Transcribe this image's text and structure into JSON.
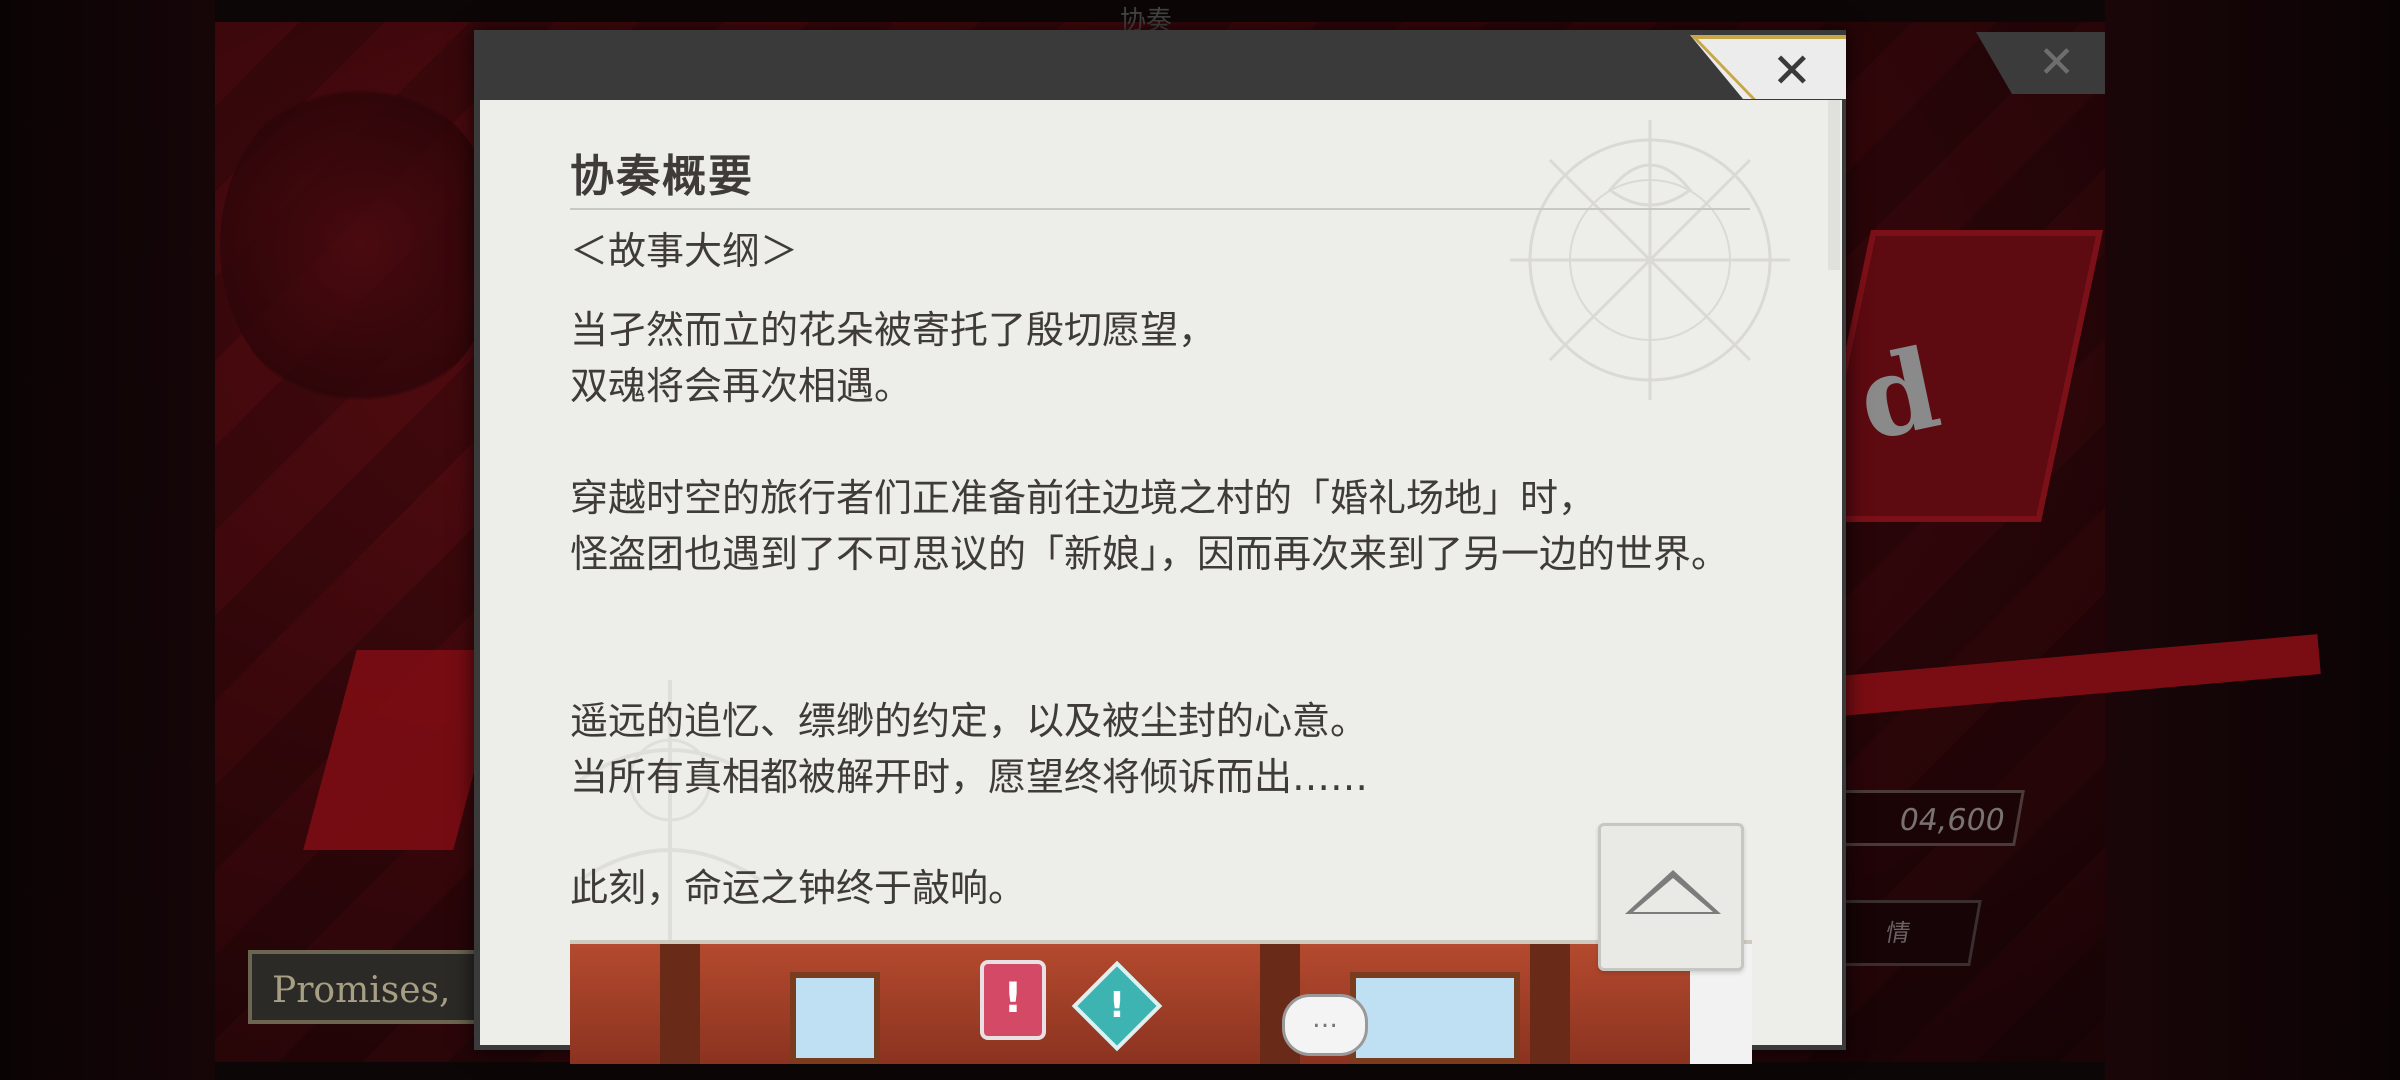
{
  "background": {
    "top_label": "协奏",
    "promises_label": "Promises,",
    "score_value": "04,600",
    "detail_label": "情",
    "card_text": "d",
    "close_symbol": "✕"
  },
  "dialog": {
    "close_symbol": "✕",
    "title": "协奏概要",
    "subtitle": "＜故事大纲＞",
    "paragraphs": [
      "当孑然而立的花朵被寄托了殷切愿望，\n双魂将会再次相遇。",
      "穿越时空的旅行者们正准备前往边境之村的「婚礼场地」时，\n怪盗团也遇到了不可思议的「新娘」，因而再次来到了另一边的世界。",
      "遥远的追忆、缥缈的约定，以及被尘封的心意。\n当所有真相都被解开时，愿望终将倾诉而出……",
      "此刻，命运之钟终于敲响。"
    ],
    "banner": {
      "badge_red": "!",
      "badge_teal": "!",
      "bubble": "…"
    }
  },
  "colors": {
    "dialog_frame": "#3a3a3a",
    "content_bg": "#ededea",
    "text": "#3e3b38",
    "accent_gold": "#c8a748",
    "bg_red": "#5a0d12"
  },
  "icons": {
    "dialog_close": "close-icon",
    "scroll_top": "chevron-up-icon"
  }
}
